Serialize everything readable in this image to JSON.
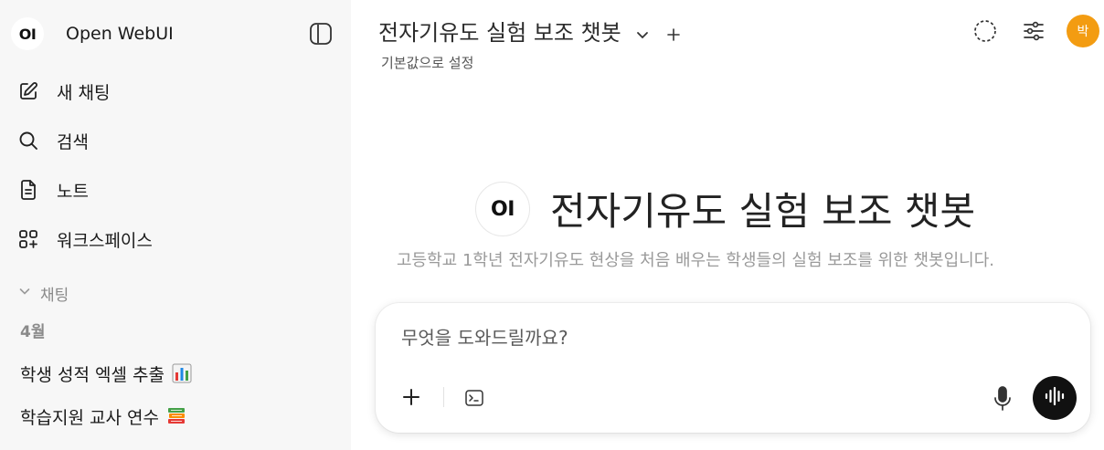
{
  "sidebar": {
    "app_logo": "OI",
    "app_name": "Open WebUI",
    "nav": [
      {
        "label": "새 채팅",
        "icon": "edit-icon"
      },
      {
        "label": "검색",
        "icon": "search-icon"
      },
      {
        "label": "노트",
        "icon": "note-icon"
      },
      {
        "label": "워크스페이스",
        "icon": "workspace-icon"
      }
    ],
    "chats_section": "채팅",
    "group": "4월",
    "chats": [
      {
        "title": "학생 성적 엑셀 추출",
        "emoji": "bar-chart-emoji"
      },
      {
        "title": "학습지원 교사 연수",
        "emoji": "books-emoji"
      }
    ]
  },
  "header": {
    "model_name": "전자기유도 실험 보조 챗봇",
    "set_default": "기본값으로 설정",
    "avatar_initial": "박",
    "avatar_color": "#f39c12"
  },
  "hero": {
    "logo": "OI",
    "title": "전자기유도 실험 보조 챗봇",
    "description": "고등학교 1학년 전자기유도 현상을 처음 배우는 학생들의 실험 보조를 위한 챗봇입니다."
  },
  "composer": {
    "placeholder": "무엇을 도와드릴까요?"
  }
}
